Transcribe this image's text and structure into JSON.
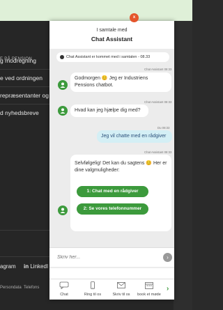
{
  "background": {
    "section_label": "E PÅ PENSION",
    "links": [
      "g modregning",
      "e ved ordningen",
      "repræsentanter og",
      "d nyhedsbreve"
    ],
    "social": [
      "agram",
      "LinkedI"
    ],
    "footer_links": [
      "Persondata",
      "Telefons"
    ]
  },
  "chat": {
    "header_sub": "I samtale med",
    "header_title": "Chat Assistant",
    "close_label": "x",
    "notice": "Chat Assistant er kommet med i samtalen - 08.33",
    "messages": [
      {
        "sender": "bot",
        "meta": "Chat Assistant 08:33",
        "text": "Godmorgen 😊 Jeg er Industriens Pensions chatbot."
      },
      {
        "sender": "bot",
        "meta": "Chat Assistant 08:33",
        "text": "Hvad kan jeg hjælpe dig med?"
      },
      {
        "sender": "user",
        "meta": "Du  08:33",
        "text": "Jeg vil chatte med en rådgiver"
      },
      {
        "sender": "bot",
        "meta": "Chat Assistant 08:33",
        "text": "Selvfølgelig! Det kan du sagtens 😊 Her er dine valgmuligheder:"
      }
    ],
    "choices": [
      "1: Chat med en rådgiver",
      "2: Se vores telefonnummer"
    ],
    "input_placeholder": "Skriv her...",
    "nav": [
      {
        "label": "Chat",
        "icon": "chat-icon"
      },
      {
        "label": "Ring til os",
        "icon": "phone-icon"
      },
      {
        "label": "Skriv til os",
        "icon": "mail-icon"
      },
      {
        "label": "book et møde",
        "icon": "calendar-icon"
      }
    ],
    "accent_color": "#3c9a3c",
    "close_color": "#e5552b"
  }
}
